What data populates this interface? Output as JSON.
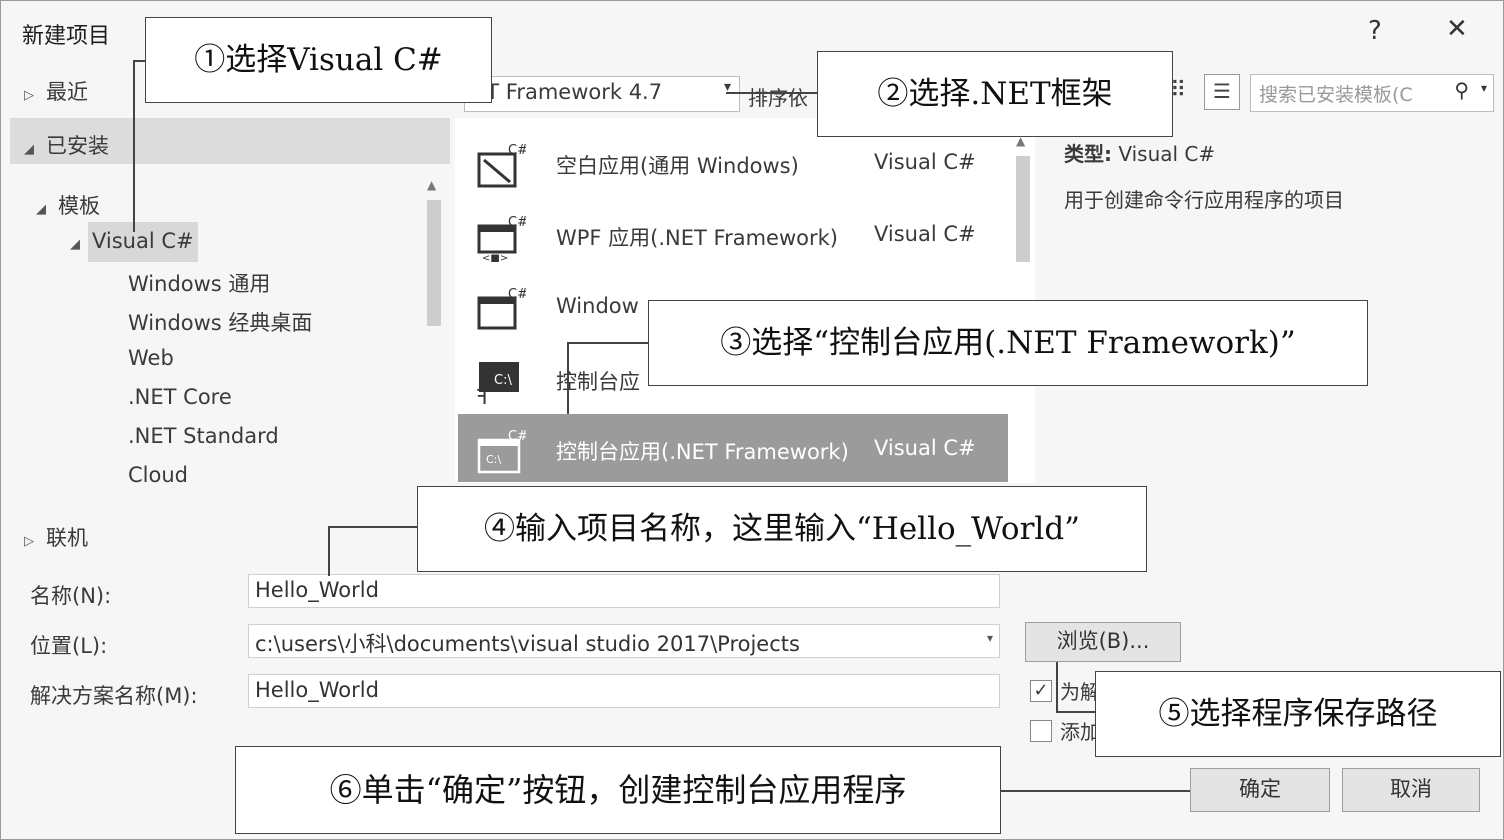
{
  "dialog": {
    "title": "新建项目",
    "help": "?",
    "close": "✕"
  },
  "tree": {
    "recent": "最近",
    "installed": "已安装",
    "templates": "模板",
    "visual_cs": "Visual C#",
    "children": [
      "Windows 通用",
      "Windows 经典桌面",
      "Web",
      ".NET Core",
      ".NET Standard",
      "Cloud"
    ],
    "online": "联机"
  },
  "toolbar": {
    "framework": "ET Framework 4.7",
    "sort_label": "排序依",
    "search_placeholder": "搜索已安装模板(C"
  },
  "templates": [
    {
      "name": "空白应用(通用 Windows)",
      "lang": "Visual C#"
    },
    {
      "name": "WPF 应用(.NET Framework)",
      "lang": "Visual C#"
    },
    {
      "name": "Window",
      "lang": ""
    },
    {
      "name": "控制台应",
      "lang": ""
    },
    {
      "name": "控制台应用(.NET Framework)",
      "lang": "Visual C#"
    }
  ],
  "info": {
    "type_label": "类型:",
    "type_value": "Visual C#",
    "description": "用于创建命令行应用程序的项目"
  },
  "form": {
    "name_label": "名称(N):",
    "name_value": "Hello_World",
    "location_label": "位置(L):",
    "location_value": "c:\\users\\小科\\documents\\visual studio 2017\\Projects",
    "solution_label": "解决方案名称(M):",
    "solution_value": "Hello_World",
    "browse": "浏览(B)...",
    "check1": "为解",
    "check2": "添加",
    "ok": "确定",
    "cancel": "取消"
  },
  "callouts": {
    "c1": "①选择Visual C#",
    "c2": "②选择.NET框架",
    "c3": "③选择“控制台应用(.NET Framework)”",
    "c4": "④输入项目名称，这里输入“Hello_World”",
    "c5": "⑤选择程序保存路径",
    "c6": "⑥单击“确定”按钮，创建控制台应用程序"
  }
}
